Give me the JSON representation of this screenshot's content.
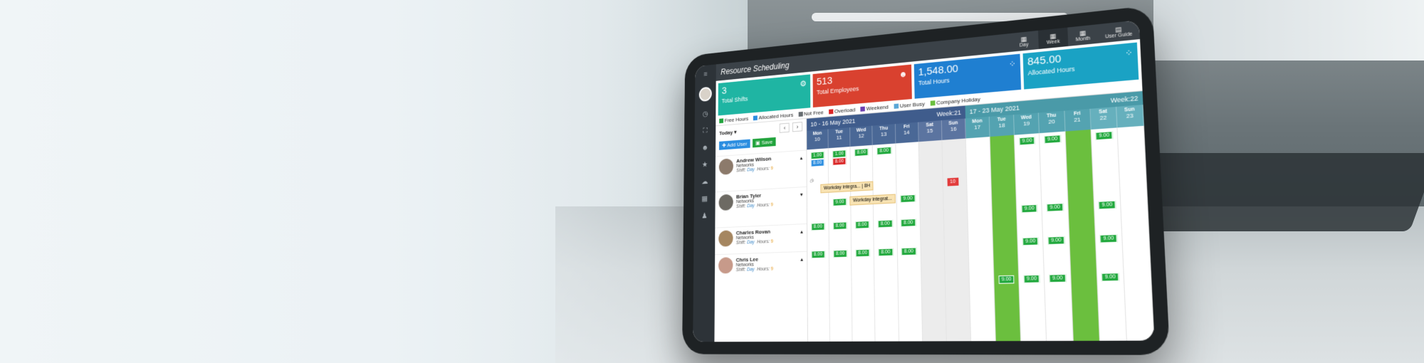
{
  "app": {
    "title": "Resource Scheduling"
  },
  "views": [
    {
      "label": "Day",
      "icon": "calendar-icon"
    },
    {
      "label": "Week",
      "icon": "calendar-icon"
    },
    {
      "label": "Month",
      "icon": "calendar-icon"
    },
    {
      "label": "User Guide",
      "icon": "guide-icon"
    }
  ],
  "stats": [
    {
      "value": "3",
      "label": "Total Shifts",
      "color": "#1fb5a3",
      "icon": "gear-icon"
    },
    {
      "value": "513",
      "label": "Total Employees",
      "color": "#d9412f",
      "icon": "users-icon"
    },
    {
      "value": "1,548.00",
      "label": "Total Hours",
      "color": "#1f7fd1",
      "icon": "dots-grid-icon"
    },
    {
      "value": "845.00",
      "label": "Allocated Hours",
      "color": "#1aa2c4",
      "icon": "dots-grid-icon"
    }
  ],
  "legend": [
    {
      "label": "Free Hours",
      "color": "#21a33c"
    },
    {
      "label": "Allocated Hours",
      "color": "#2a8de0"
    },
    {
      "label": "Not Free",
      "color": "#666c70"
    },
    {
      "label": "Overload",
      "color": "#d92626"
    },
    {
      "label": "Weekend",
      "color": "#6b3fb0"
    },
    {
      "label": "User Busy",
      "color": "#5aa6d6"
    },
    {
      "label": "Company Holiday",
      "color": "#6bbf3e"
    }
  ],
  "toolbar": {
    "today": "Today",
    "prev": "‹",
    "next": "›",
    "add_user": "Add User",
    "save": "Save"
  },
  "weeks": [
    {
      "range": "10 - 16 May 2021",
      "label": "Week:21",
      "color": "#3f5c8c"
    },
    {
      "range": "17 - 23 May 2021",
      "label": "Week:22",
      "color": "#4a9aa8"
    }
  ],
  "days": [
    {
      "d": "Mon",
      "n": "10"
    },
    {
      "d": "Tue",
      "n": "11"
    },
    {
      "d": "Wed",
      "n": "12"
    },
    {
      "d": "Thu",
      "n": "13"
    },
    {
      "d": "Fri",
      "n": "14"
    },
    {
      "d": "Sat",
      "n": "15"
    },
    {
      "d": "Sun",
      "n": "16"
    },
    {
      "d": "Mon",
      "n": "17"
    },
    {
      "d": "Tue",
      "n": "18"
    },
    {
      "d": "Wed",
      "n": "19"
    },
    {
      "d": "Thu",
      "n": "20"
    },
    {
      "d": "Fri",
      "n": "21"
    },
    {
      "d": "Sat",
      "n": "22"
    },
    {
      "d": "Sun",
      "n": "23"
    }
  ],
  "users": [
    {
      "name": "Andrew Wilson",
      "dept": "Networks",
      "shift_label": "Shift:",
      "shift": "Day",
      "hours_label": "Hours:",
      "hours": "9"
    },
    {
      "name": "Brian Tyler",
      "dept": "Networks",
      "shift_label": "Shift:",
      "shift": "Day",
      "hours_label": "Hours:",
      "hours": "9"
    },
    {
      "name": "Charles Rovan",
      "dept": "Networks",
      "shift_label": "Shift:",
      "shift": "Day",
      "hours_label": "Hours:",
      "hours": "9"
    },
    {
      "name": "Chris Lee",
      "dept": "Networks",
      "shift_label": "Shift:",
      "shift": "Day",
      "hours_label": "Hours:",
      "hours": "9"
    }
  ],
  "chips": {
    "a": "1.00",
    "b": "9.00",
    "c": "8.00"
  },
  "tasks": {
    "t1": "Workday integra...",
    "t1b": "8H",
    "t2": "Workday integrat...",
    "ovl": "10"
  }
}
